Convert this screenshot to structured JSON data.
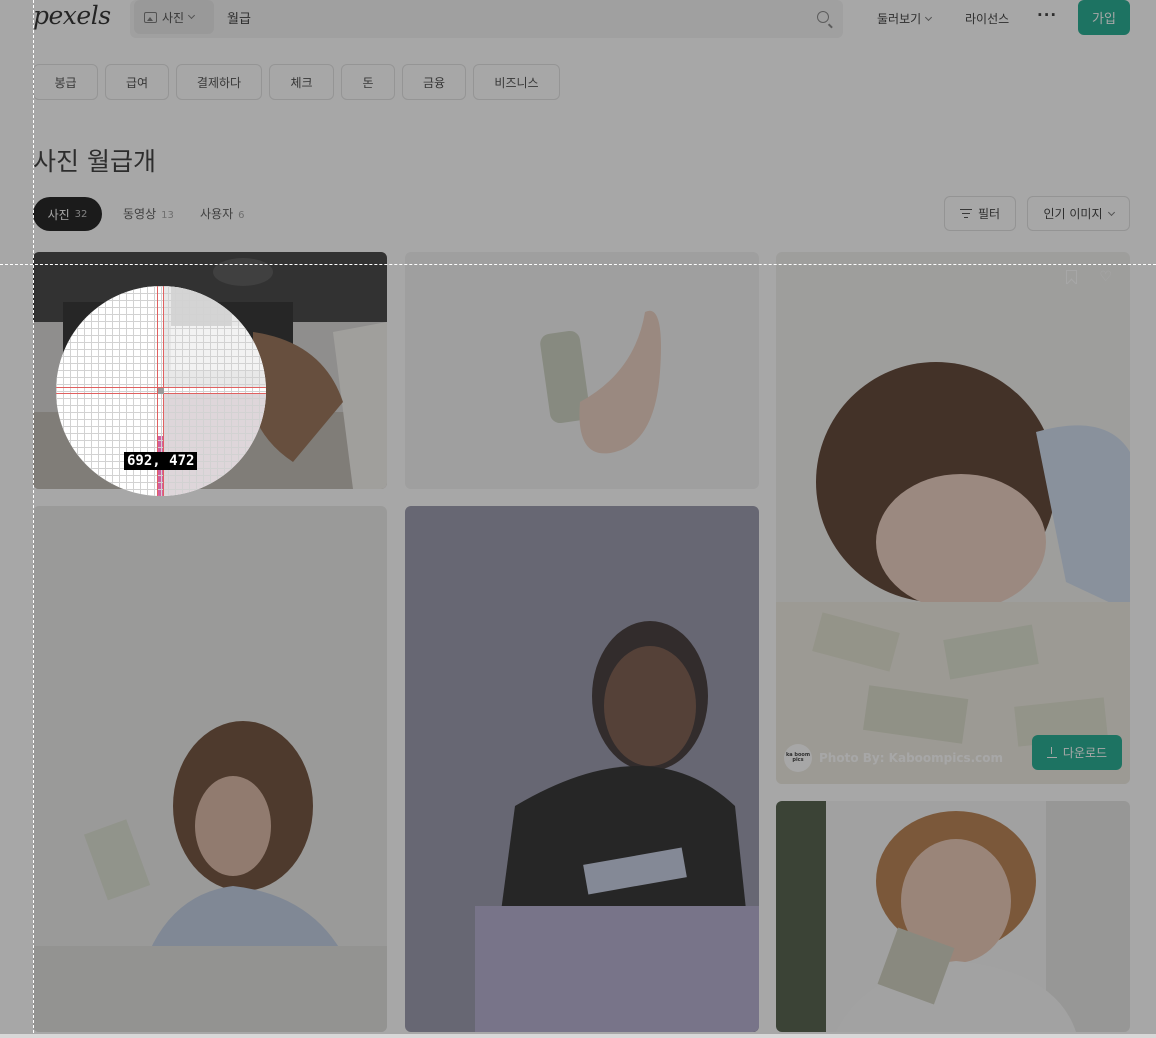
{
  "header": {
    "logo": "pexels",
    "search_type": "사진",
    "search_query": "월급",
    "nav_explore": "둘러보기",
    "nav_license": "라이선스",
    "nav_more": "···",
    "join_label": "가입"
  },
  "chips": [
    "봉급",
    "급여",
    "결제하다",
    "체크",
    "돈",
    "금융",
    "비즈니스"
  ],
  "page_title": "사진 월급개",
  "tabs": {
    "photos": {
      "label": "사진",
      "count": "32"
    },
    "videos": {
      "label": "동영상",
      "count": "13"
    },
    "users": {
      "label": "사용자",
      "count": "6"
    }
  },
  "toolbar": {
    "filter_label": "필터",
    "sort_label": "인기 이미지"
  },
  "featured_card": {
    "author": "Photo By: Kaboompics.com",
    "avatar_text": "ka boom pics",
    "download_label": "다운로드"
  },
  "magnifier": {
    "coordinates": "692, 472"
  },
  "colors": {
    "brand_green": "#05a081",
    "dim_overlay": "rgba(60,60,60,0.45)"
  }
}
